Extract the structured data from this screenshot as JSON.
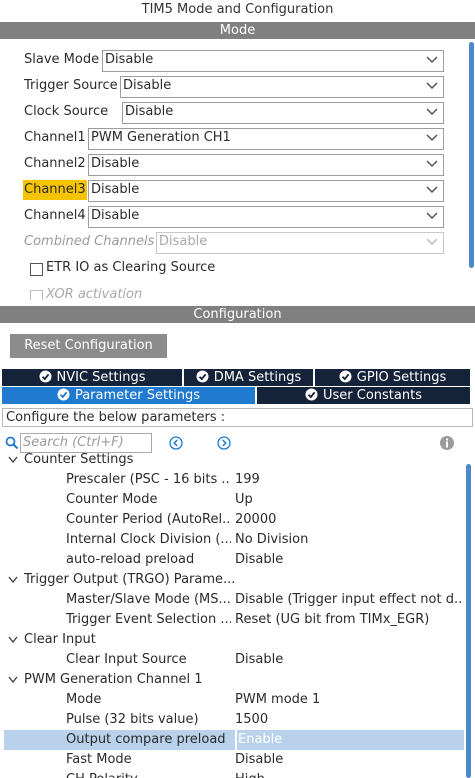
{
  "window_title": "TIM5 Mode and Configuration",
  "mode_section": {
    "header": "Mode",
    "rows": [
      {
        "label": "Slave Mode",
        "value": "Disable"
      },
      {
        "label": "Trigger Source",
        "value": "Disable"
      },
      {
        "label": "Clock Source",
        "value": "Disable"
      },
      {
        "label": "Channel1",
        "value": "PWM Generation CH1"
      },
      {
        "label": "Channel2",
        "value": "Disable"
      },
      {
        "label": "Channel3",
        "value": "Disable"
      },
      {
        "label": "Channel4",
        "value": "Disable"
      },
      {
        "label": "Combined Channels",
        "value": "Disable"
      }
    ],
    "checkboxes": [
      {
        "label": "ETR IO as Clearing Source"
      },
      {
        "label": "XOR activation"
      }
    ]
  },
  "config_section": {
    "header": "Configuration",
    "reset_button": "Reset Configuration",
    "tabs_row1": [
      "NVIC Settings",
      "DMA Settings",
      "GPIO Settings"
    ],
    "tabs_row2": [
      "Parameter Settings",
      "User Constants"
    ],
    "description": "Configure the below parameters :",
    "search_placeholder": "Search (Ctrl+F)",
    "tree": {
      "group_counter": "Counter Settings",
      "prescaler": {
        "label": "Prescaler (PSC - 16 bits ...",
        "value": "199"
      },
      "counter_mode": {
        "label": "Counter Mode",
        "value": "Up"
      },
      "counter_period": {
        "label": "Counter Period (AutoRel...",
        "value": "20000"
      },
      "clock_division": {
        "label": "Internal Clock Division (...",
        "value": "No Division"
      },
      "auto_reload": {
        "label": "auto-reload preload",
        "value": "Disable"
      },
      "group_trgo": "Trigger Output (TRGO) Parame...",
      "master_slave": {
        "label": "Master/Slave Mode (MS...",
        "value": "Disable (Trigger input effect not d..."
      },
      "trigger_event": {
        "label": "Trigger Event Selection ...",
        "value": "Reset (UG bit from TIMx_EGR)"
      },
      "group_clear": "Clear Input",
      "clear_source": {
        "label": "Clear Input Source",
        "value": "Disable"
      },
      "group_pwm": "PWM Generation Channel 1",
      "pwm_mode": {
        "label": "Mode",
        "value": "PWM mode 1"
      },
      "pulse": {
        "label": "Pulse (32 bits value)",
        "value": "1500"
      },
      "output_preload": {
        "label": "Output compare preload",
        "value": "Enable"
      },
      "fast_mode": {
        "label": "Fast Mode",
        "value": "Disable"
      },
      "ch_polarity": {
        "label": "CH Polarity",
        "value": "High"
      }
    }
  },
  "colors": {
    "accent_tab": "#1f7ad0",
    "dark_tab": "#15233a",
    "highlight": "#f5c400",
    "section_bar": "#808080",
    "selected_row": "#b9d1ea"
  }
}
